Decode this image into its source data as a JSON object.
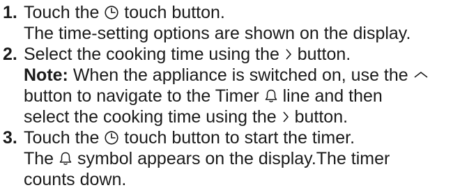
{
  "steps": [
    {
      "number": "1.",
      "lines": [
        [
          "Touch the ",
          "{clock}",
          " touch button."
        ],
        [
          "The time-setting options are shown on the display."
        ]
      ]
    },
    {
      "number": "2.",
      "lines": [
        [
          "Select the cooking time using the ",
          "{chevron-right}",
          " button."
        ]
      ],
      "note": {
        "label": "Note:",
        "lines": [
          [
            " When the appliance is switched on, use the ",
            "{chevron-up}"
          ],
          [
            "button to navigate to the Timer ",
            "{bell}",
            " line and then"
          ],
          [
            "select the cooking time using the ",
            "{chevron-right}",
            " button."
          ]
        ]
      }
    },
    {
      "number": "3.",
      "lines": [
        [
          "Touch the ",
          "{clock}",
          " touch button to start the timer."
        ],
        [
          "The ",
          "{bell}",
          " symbol appears on the display.The timer"
        ],
        [
          "counts down."
        ]
      ]
    }
  ],
  "icons": {
    "clock": "clock-icon",
    "chevron-right": "chevron-right-icon",
    "chevron-up": "chevron-up-icon",
    "bell": "bell-icon"
  },
  "colors": {
    "text": "#1a1a1a",
    "background": "#ffffff"
  }
}
